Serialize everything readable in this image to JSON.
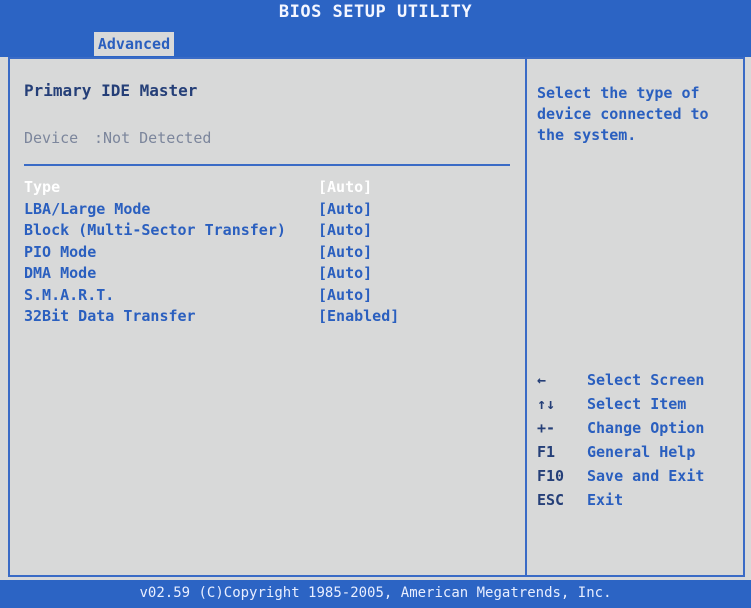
{
  "header": {
    "title": "BIOS SETUP UTILITY",
    "active_tab": "Advanced"
  },
  "left_panel": {
    "section_title": "Primary IDE Master",
    "device": {
      "label": "Device",
      "value": ":Not Detected"
    },
    "settings": [
      {
        "label": "Type",
        "value": "[Auto]",
        "selected": true
      },
      {
        "label": "LBA/Large Mode",
        "value": "[Auto]"
      },
      {
        "label": "Block (Multi-Sector Transfer)",
        "value": "[Auto]"
      },
      {
        "label": "PIO Mode",
        "value": "[Auto]"
      },
      {
        "label": "DMA Mode",
        "value": "[Auto]"
      },
      {
        "label": "S.M.A.R.T.",
        "value": "[Auto]"
      },
      {
        "label": "32Bit Data Transfer",
        "value": "[Enabled]"
      }
    ]
  },
  "right_panel": {
    "help_text": "Select the type of device connected to the system.",
    "keys": [
      {
        "key": "←",
        "desc": "Select Screen"
      },
      {
        "key": "↑↓",
        "desc": "Select Item"
      },
      {
        "key": "+-",
        "desc": "Change Option"
      },
      {
        "key": "F1",
        "desc": "General Help"
      },
      {
        "key": "F10",
        "desc": "Save and Exit"
      },
      {
        "key": "ESC",
        "desc": "Exit"
      }
    ]
  },
  "footer": {
    "copyright": "v02.59 (C)Copyright 1985-2005, American Megatrends, Inc."
  },
  "colors": {
    "bar_blue": "#2c64c4",
    "background": "#d8d9d9",
    "text_blue": "#2a5fbf",
    "selected_text": "#ffffff"
  }
}
